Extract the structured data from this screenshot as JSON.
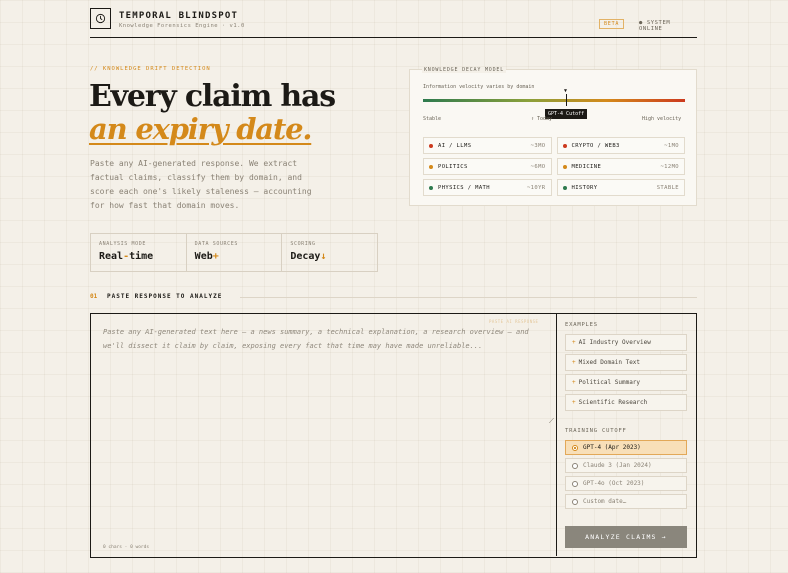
{
  "header": {
    "title": "TEMPORAL BLINDSPOT",
    "subtitle": "Knowledge Forensics Engine · v1.0",
    "beta_badge": "BETA",
    "status": "● SYSTEM ONLINE",
    "logo_icon": "clock-icon"
  },
  "hero": {
    "kicker": "// KNOWLEDGE DRIFT DETECTION",
    "headline_1": "Every claim has",
    "headline_2": "an expiry date.",
    "description": "Paste any AI-generated response. We extract factual claims, classify them by domain, and score each one's likely staleness — accounting for how fast that domain moves."
  },
  "stats": [
    {
      "label": "ANALYSIS MODE",
      "value": "Real-time",
      "accent": "-"
    },
    {
      "label": "DATA SOURCES",
      "value": "Web",
      "accent": "+"
    },
    {
      "label": "SCORING",
      "value": "Decay",
      "accent": "↓"
    }
  ],
  "decay_model": {
    "label": "KNOWLEDGE DECAY MODEL",
    "subtitle": "Information velocity varies by domain",
    "tooltip": "GPT-4 Cutoff",
    "scale_left": "Stable",
    "scale_mid": "↑ Today",
    "scale_right": "High velocity",
    "domains": [
      {
        "name": "AI / LLMS",
        "rate": "~3MO",
        "color": "#cc3a1e"
      },
      {
        "name": "CRYPTO / WEB3",
        "rate": "~1MO",
        "color": "#cc3a1e"
      },
      {
        "name": "POLITICS",
        "rate": "~6MO",
        "color": "#d4891a"
      },
      {
        "name": "MEDICINE",
        "rate": "~12MO",
        "color": "#d4891a"
      },
      {
        "name": "PHYSICS / MATH",
        "rate": "~10YR",
        "color": "#2e7a4e"
      },
      {
        "name": "HISTORY",
        "rate": "STABLE",
        "color": "#2e7a4e"
      }
    ]
  },
  "section": {
    "number": "01",
    "title": "PASTE RESPONSE TO ANALYZE"
  },
  "input": {
    "placeholder": "Paste any AI-generated text here — a news summary, a technical explanation, a research overview — and we'll dissect it claim by claim, exposing every fact that time may have made unreliable...",
    "paste_hint": "PASTE AI RESPONSE",
    "counter": "0 chars · 0 words"
  },
  "sidebar": {
    "examples_label": "EXAMPLES",
    "examples": [
      "AI Industry Overview",
      "Mixed Domain Text",
      "Political Summary",
      "Scientific Research"
    ],
    "cutoff_label": "TRAINING CUTOFF",
    "cutoffs": [
      {
        "label": "GPT-4 (Apr 2023)",
        "selected": true
      },
      {
        "label": "Claude 3 (Jan 2024)",
        "selected": false
      },
      {
        "label": "GPT-4o (Oct 2023)",
        "selected": false
      },
      {
        "label": "Custom date…",
        "selected": false
      }
    ],
    "analyze_button": "ANALYZE CLAIMS →"
  },
  "colors": {
    "accent": "#d4891a",
    "ink": "#1c1a16",
    "background": "#f4f0e8",
    "high_velocity": "#cc3a1e",
    "stable": "#2e7a4e"
  }
}
